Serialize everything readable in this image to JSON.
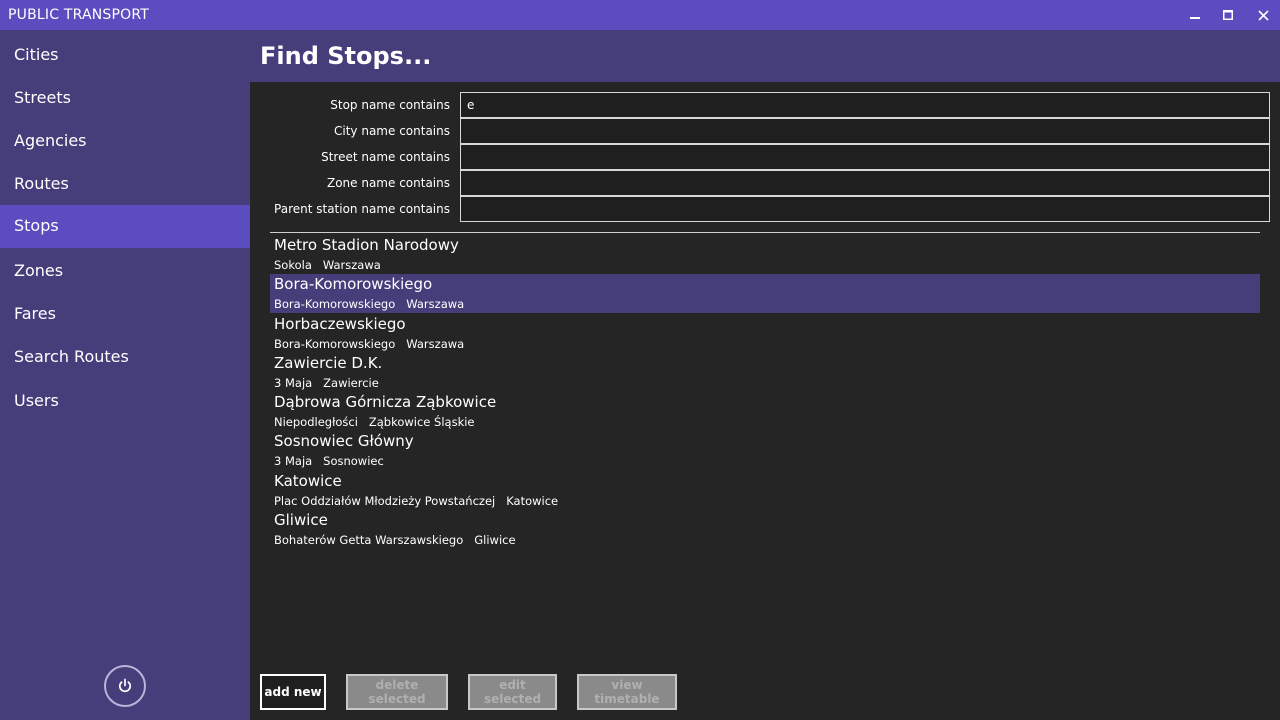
{
  "app": {
    "title": "PUBLIC TRANSPORT"
  },
  "sidebar": {
    "items": [
      {
        "label": "Cities"
      },
      {
        "label": "Streets"
      },
      {
        "label": "Agencies"
      },
      {
        "label": "Routes"
      },
      {
        "label": "Stops",
        "active": true
      },
      {
        "label": "Zones"
      },
      {
        "label": "Fares"
      },
      {
        "label": "Search Routes"
      },
      {
        "label": "Users"
      }
    ],
    "power_icon": "power-icon"
  },
  "page": {
    "title": "Find Stops..."
  },
  "filters": [
    {
      "label": "Stop name contains",
      "value": "e",
      "placeholder": ""
    },
    {
      "label": "City name contains",
      "value": "",
      "placeholder": ""
    },
    {
      "label": "Street name contains",
      "value": "",
      "placeholder": ""
    },
    {
      "label": "Zone name contains",
      "value": "",
      "placeholder": ""
    },
    {
      "label": "Parent station name contains",
      "value": "",
      "placeholder": ""
    }
  ],
  "results": [
    {
      "name": "Metro Stadion Narodowy",
      "street": "Sokola",
      "city": "Warszawa"
    },
    {
      "name": "Bora-Komorowskiego",
      "street": "Bora-Komorowskiego",
      "city": "Warszawa",
      "selected": true
    },
    {
      "name": "Horbaczewskiego",
      "street": "Bora-Komorowskiego",
      "city": "Warszawa"
    },
    {
      "name": "Zawiercie D.K.",
      "street": "3 Maja",
      "city": "Zawiercie"
    },
    {
      "name": "Dąbrowa Górnicza Ząbkowice",
      "street": "Niepodległości",
      "city": "Ząbkowice Śląskie"
    },
    {
      "name": "Sosnowiec Główny",
      "street": "3 Maja",
      "city": "Sosnowiec"
    },
    {
      "name": "Katowice",
      "street": "Plac Oddziałów Młodzieży Powstańczej",
      "city": "Katowice"
    },
    {
      "name": "Gliwice",
      "street": "Bohaterów Getta Warszawskiego",
      "city": "Gliwice"
    }
  ],
  "actions": {
    "add_new": "add new",
    "delete_selected": "delete selected",
    "edit_selected": "edit selected",
    "view_timetable": "view timetable"
  },
  "colors": {
    "accent": "#5b4cbf",
    "sidebar": "#463d7b",
    "background": "#252525",
    "selected_row": "#463d7b"
  }
}
